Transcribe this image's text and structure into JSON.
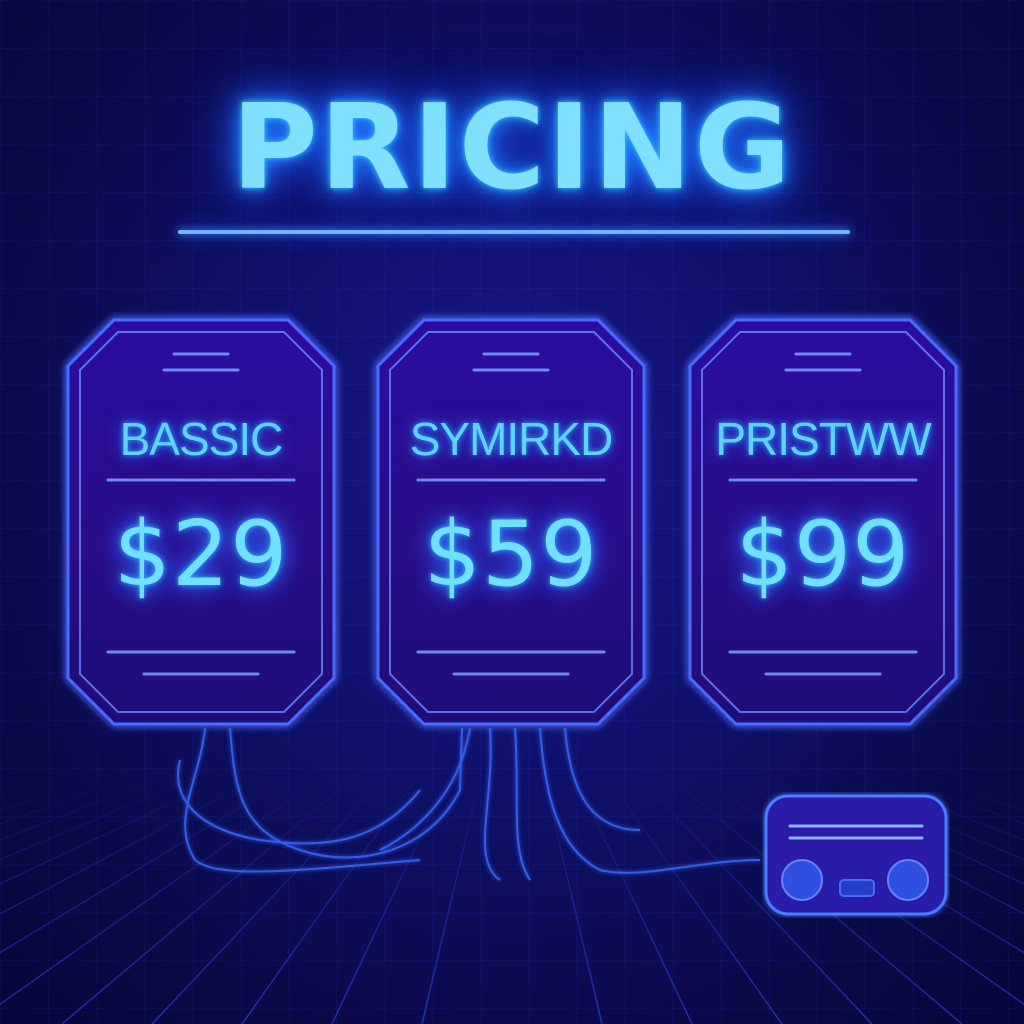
{
  "title": "PRICING",
  "plans": [
    {
      "name": "BASSIC",
      "price": "$29"
    },
    {
      "name": "SYMIRKD",
      "price": "$59"
    },
    {
      "name": "PRISTWW",
      "price": "$99"
    }
  ],
  "colors": {
    "background": "#0a0a4a",
    "neon_cyan": "#7fe0ff",
    "neon_blue": "#3a5cff",
    "card_fill": "#2a0e8e"
  },
  "icons": [
    "radio-device-icon"
  ]
}
